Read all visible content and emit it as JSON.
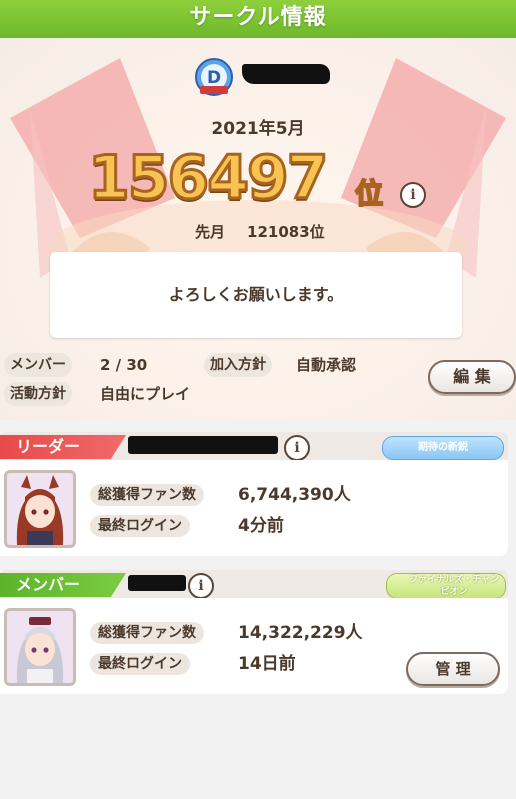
{
  "window": {
    "title": "サークル情報"
  },
  "circle": {
    "rank_period": "2021年5月",
    "rank": "156497",
    "rank_unit": "位",
    "prev_label": "先月",
    "prev_rank": "121083位",
    "message": "よろしくお願いします。",
    "badge_letter": "D"
  },
  "info": {
    "members_label": "メンバー",
    "members_value": "2 / 30",
    "join_policy_label": "加入方針",
    "join_policy_value": "自動承認",
    "activity_label": "活動方針",
    "activity_value": "自由にプレイ",
    "edit_button": "編 集"
  },
  "members": [
    {
      "role": "リーダー",
      "title_badge": "期待の新鋭",
      "fans_label": "総獲得ファン数",
      "fans_value": "6,744,390人",
      "login_label": "最終ログイン",
      "login_value": "4分前"
    },
    {
      "role": "メンバー",
      "title_badge": "ファイナルズ・チャンピオン",
      "fans_label": "総獲得ファン数",
      "fans_value": "14,322,229人",
      "login_label": "最終ログイン",
      "login_value": "14日前",
      "manage_button": "管 理"
    }
  ],
  "colors": {
    "header": "#78c030",
    "leader": "#e84a4a",
    "member": "#6cc034",
    "rank_gold": "#f7c454"
  }
}
